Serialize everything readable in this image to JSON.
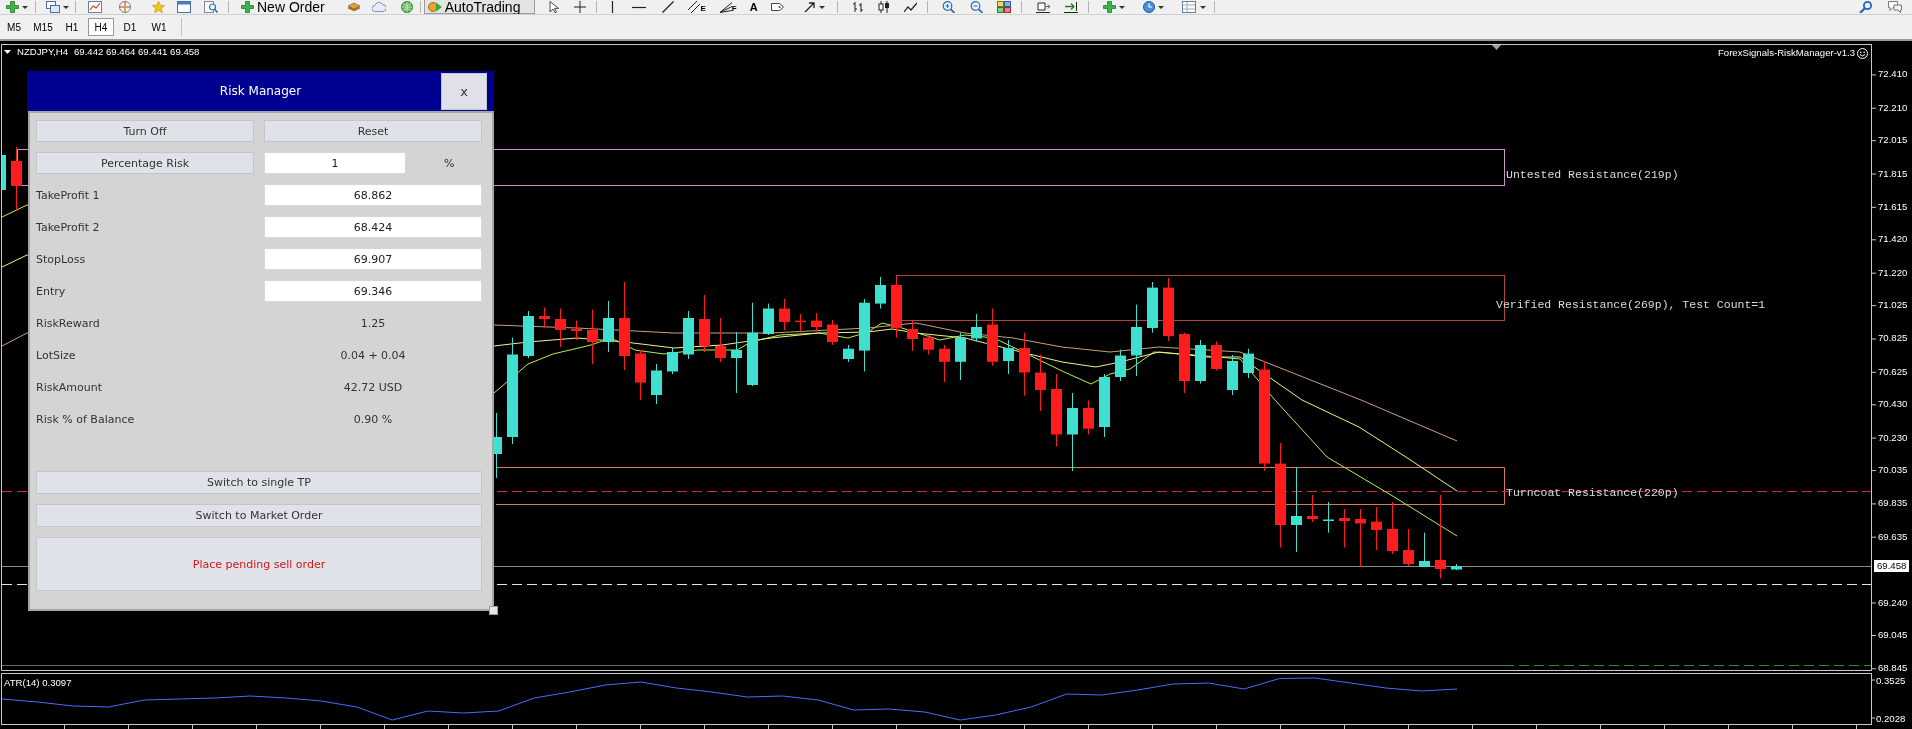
{
  "toolbar": {
    "buttons": [
      {
        "label": "New Order",
        "on": false
      },
      {
        "label": "AutoTrading",
        "on": true
      }
    ],
    "glyphs": [
      "E",
      "F",
      "A"
    ]
  },
  "timeframes": [
    {
      "label": "M5",
      "selected": false
    },
    {
      "label": "M15",
      "selected": false
    },
    {
      "label": "H1",
      "selected": false
    },
    {
      "label": "H4",
      "selected": true
    },
    {
      "label": "D1",
      "selected": false
    },
    {
      "label": "W1",
      "selected": false
    }
  ],
  "chart": {
    "symbol": "NZDJPY,H4",
    "quote": "69.442 69.464 69.441 69.458",
    "indicator": "ForexSignals-RiskManager-v1.3",
    "zones": [
      {
        "label": "Untested Resistance(219p)",
        "color": "#c896c8"
      },
      {
        "label": "Verified Resistance(269p), Test Count=1",
        "color": "#b04545"
      },
      {
        "label": "Turncoat Resistance(220p)",
        "color": "#d87a5a"
      }
    ],
    "price_axis": {
      "labels": [
        "72.410",
        "72.210",
        "72.015",
        "71.815",
        "71.615",
        "71.420",
        "71.220",
        "71.025",
        "70.825",
        "70.625",
        "70.430",
        "70.230",
        "70.035",
        "69.835",
        "69.635",
        "69.240",
        "69.045",
        "68.845"
      ],
      "current_price": "69.458"
    }
  },
  "risk_manager": {
    "title": "Risk Manager",
    "close": "x",
    "buttons": [
      "Turn Off",
      "Reset"
    ],
    "risk_mode": {
      "label": "Percentage Risk",
      "value": "1",
      "unit": "%"
    },
    "fields": [
      {
        "label": "TakeProfit 1",
        "value": "68.862",
        "kind": "input"
      },
      {
        "label": "TakeProfit 2",
        "value": "68.424",
        "kind": "input"
      },
      {
        "label": "StopLoss",
        "value": "69.907",
        "kind": "input"
      },
      {
        "label": "Entry",
        "value": "69.346",
        "kind": "input"
      },
      {
        "label": "RiskReward",
        "value": "1.25",
        "kind": "readout"
      },
      {
        "label": "LotSize",
        "value": "0.04 + 0.04",
        "kind": "readout"
      },
      {
        "label": "RiskAmount",
        "value": "42.72 USD",
        "kind": "readout"
      },
      {
        "label": "Risk % of Balance",
        "value": "0.90 %",
        "kind": "readout"
      }
    ],
    "switches": [
      "Switch to single TP",
      "Switch to Market Order"
    ],
    "action": "Place pending sell order"
  },
  "indicator_window": {
    "label": "ATR(14) 0.3097",
    "scale_labels": [
      "0.3525",
      "0.2028"
    ]
  }
}
